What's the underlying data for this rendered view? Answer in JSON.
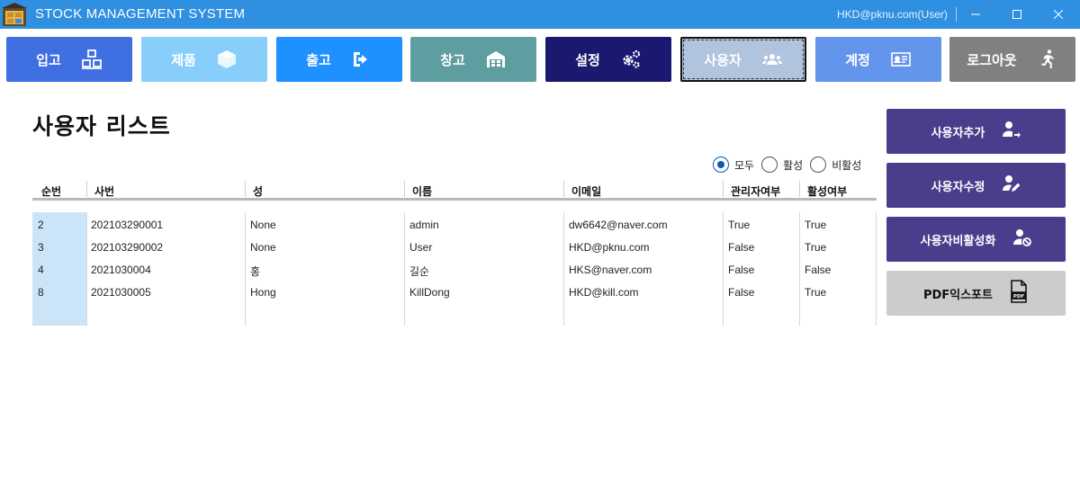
{
  "window": {
    "title": "STOCK MANAGEMENT SYSTEM",
    "user_label": "HKD@pknu.com(User)",
    "controls": [
      "minimize-icon",
      "maximize-icon",
      "close-icon"
    ]
  },
  "nav": [
    {
      "label": "입고",
      "icon": "inbound-boxes-icon",
      "color": "#3f6fe0"
    },
    {
      "label": "제품",
      "icon": "product-cube-icon",
      "color": "#87cefa"
    },
    {
      "label": "출고",
      "icon": "outbound-exit-icon",
      "color": "#1e90ff"
    },
    {
      "label": "창고",
      "icon": "warehouse-icon",
      "color": "#5f9ea0"
    },
    {
      "label": "설정",
      "icon": "settings-gears-icon",
      "color": "#191970"
    },
    {
      "label": "사용자",
      "icon": "users-icon",
      "color": "#b0c4de",
      "active": true
    },
    {
      "label": "계정",
      "icon": "account-card-icon",
      "color": "#6495ed"
    },
    {
      "label": "로그아웃",
      "icon": "logout-run-icon",
      "color": "#808080"
    }
  ],
  "page": {
    "title": "사용자 리스트"
  },
  "filter": {
    "options": [
      "모두",
      "활성",
      "비활성"
    ],
    "selected": "모두"
  },
  "table": {
    "columns": [
      "순번",
      "사번",
      "성",
      "이름",
      "이메일",
      "관리자여부",
      "활성여부"
    ],
    "rows": [
      [
        "2",
        "202103290001",
        "None",
        "admin",
        "dw6642@naver.com",
        "True",
        "True"
      ],
      [
        "3",
        "202103290002",
        "None",
        "User",
        "HKD@pknu.com",
        "False",
        "True"
      ],
      [
        "4",
        "2021030004",
        "홍",
        "길순",
        "HKS@naver.com",
        "False",
        "False"
      ],
      [
        "8",
        "2021030005",
        "Hong",
        "KillDong",
        "HKD@kill.com",
        "False",
        "True"
      ]
    ]
  },
  "actions": [
    {
      "label": "사용자추가",
      "icon": "user-add-icon"
    },
    {
      "label": "사용자수정",
      "icon": "user-edit-icon"
    },
    {
      "label": "사용자비활성화",
      "icon": "user-disable-icon"
    },
    {
      "label": "PDF익스포트",
      "icon": "pdf-file-icon"
    }
  ],
  "colors": {
    "titlebar": "#2f8fe0",
    "action_purple": "#493e8c",
    "selection_column": "#cce4f7"
  }
}
